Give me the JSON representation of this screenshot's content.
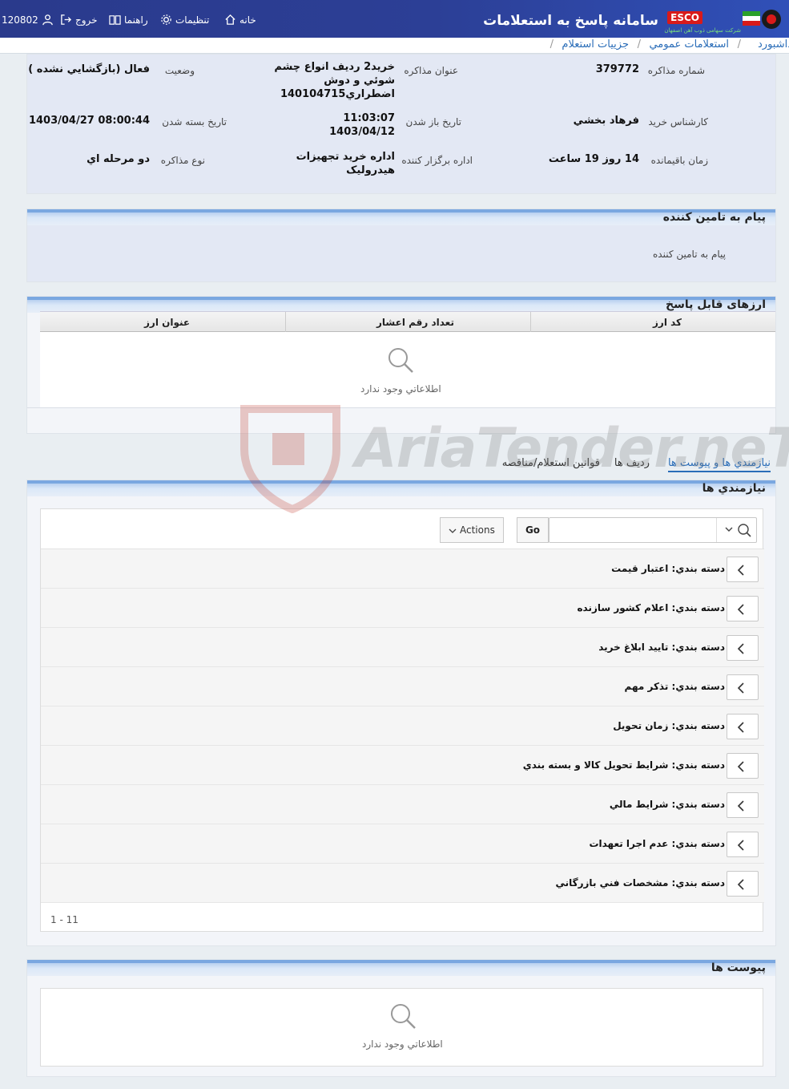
{
  "header": {
    "app_title": "سامانه پاسخ به استعلامات",
    "esco_badge": "ESCO",
    "company_sub": "شرکت سهامی ذوب آهن اصفهان",
    "nav": {
      "home": "خانه",
      "settings": "تنظيمات",
      "help": "راهنما",
      "logout": "خروج",
      "user_id": "120802"
    }
  },
  "breadcrumb": {
    "items": [
      "داشبورد",
      "استعلامات عمومي",
      "جزييات استعلام"
    ],
    "separator": "/"
  },
  "info": {
    "number_label": "شماره مذاکره",
    "number_value": "379772",
    "title_label": "عنوان مذاکره",
    "title_value_1": "خريد2 رديف انواع چشم",
    "title_value_2": "شوئي و دوش",
    "title_value_3": "اضطراري140104715",
    "status_label": "وضعيت",
    "status_value": "فعال (بازگشايي نشده )",
    "buyer_label": "کارشناس خريد",
    "buyer_value": "فرهاد بخشي",
    "open_label": "تاريخ باز شدن",
    "open_time": "11:03:07",
    "open_date": "1403/04/12",
    "close_label": "تاريخ بسته شدن",
    "close_value": "1403/04/27 08:00:44",
    "remaining_label": "زمان باقيمانده",
    "remaining_value": "14 روز 19 ساعت",
    "dept_label": "اداره برگزار کننده",
    "dept_value_1": "اداره خريد تجهيزات",
    "dept_value_2": "هيدروليک",
    "type_label": "نوع مذاکره",
    "type_value": "دو مرحله اي"
  },
  "message": {
    "title": "پيام به تامين کننده",
    "body": "پيام به تامين کننده"
  },
  "currency": {
    "title": "ارزهای قابل پاسخ",
    "columns": [
      "کد ارز",
      "تعداد رقم اعشار",
      "عنوان ارز"
    ],
    "empty_text": "اطلاعاتي وجود ندارد"
  },
  "tabs": [
    "نيازمندي ها و پيوست ها",
    "رديف ها",
    "قوانين استعلام/مناقصه"
  ],
  "requirements": {
    "title": "نيازمندي ها",
    "go_label": "Go",
    "actions_label": "Actions",
    "search_value": "",
    "groups": [
      "دسته بندي: اعتبار قيمت",
      "دسته بندي: اعلام کشور سازنده",
      "دسته بندي: تاييد ابلاغ خريد",
      "دسته بندي: تذکر مهم",
      "دسته بندي: زمان تحويل",
      "دسته بندي: شرايط تحويل کالا و بسته بندي",
      "دسته بندي: شرايط مالي",
      "دسته بندي: عدم اجرا تعهدات",
      "دسته بندي: مشخصات فني بازرگاني"
    ],
    "pager": "1 - 11"
  },
  "attachments": {
    "title": "پيوست ها",
    "empty_text": "اطلاعاتي وجود ندارد"
  },
  "watermark": {
    "text": "AriaTender.neT",
    "color": "#c0392b"
  }
}
